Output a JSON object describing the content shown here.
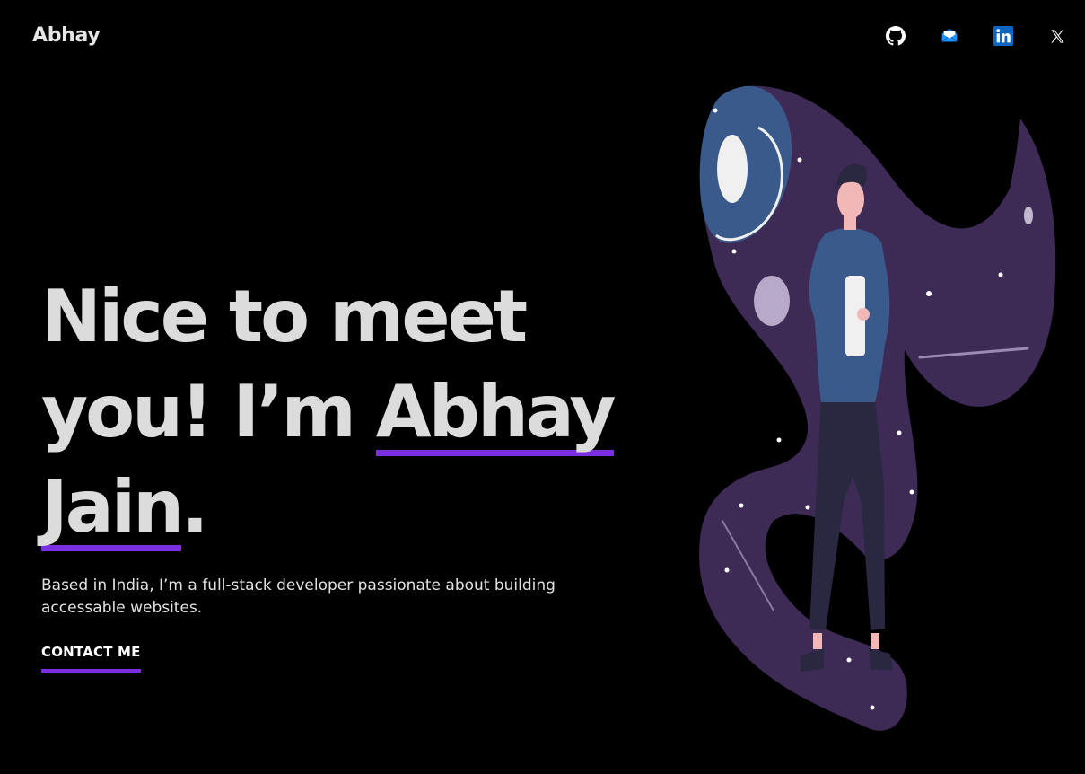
{
  "header": {
    "brand": "Abhay"
  },
  "social": [
    {
      "name": "github-icon",
      "label": "GitHub"
    },
    {
      "name": "mail-icon",
      "label": "Email"
    },
    {
      "name": "linkedin-icon",
      "label": "LinkedIn"
    },
    {
      "name": "x-icon",
      "label": "X"
    }
  ],
  "hero": {
    "line1": "Nice to meet",
    "line2_prefix": "you! I’m ",
    "name_first": "Abhay",
    "name_last": "Jain",
    "period": ".",
    "intro": "Based in India, I’m a full-stack developer passionate about building accessable websites.",
    "cta": "CONTACT ME"
  },
  "colors": {
    "background": "#000000",
    "accent": "#7b2ee0",
    "text": "#dcdcdc",
    "blob": "#3d2a55",
    "planet": "#3a5a8c"
  }
}
